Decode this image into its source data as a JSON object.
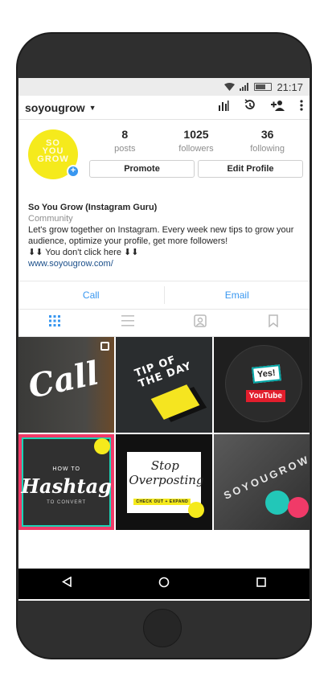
{
  "status_bar": {
    "time": "21:17"
  },
  "header": {
    "username": "soyougrow"
  },
  "profile": {
    "avatar_text": [
      "SO",
      "YOU",
      "GROW"
    ],
    "stats": [
      {
        "value": "8",
        "label": "posts"
      },
      {
        "value": "1025",
        "label": "followers"
      },
      {
        "value": "36",
        "label": "following"
      }
    ],
    "promote_label": "Promote",
    "edit_label": "Edit Profile"
  },
  "bio": {
    "name": "So You Grow (Instagram Guru)",
    "category": "Community",
    "line1": "Let's grow together on Instagram. Every week new tips to grow your",
    "line2": "audience, optimize your profile, get more followers!",
    "line3": "⬇⬇ You don't click here ⬇⬇",
    "link": "www.soyougrow.com/"
  },
  "contact": {
    "call_label": "Call",
    "email_label": "Email"
  },
  "posts": {
    "tile1_text": "Call",
    "tile2_text": "TIP OF THE DAY",
    "tile3_text_top": "Yes!",
    "tile3_text_bottom": "YouTube",
    "tile4_text_top": "HOW TO",
    "tile4_text_main": "Hashtag",
    "tile4_text_bottom": "TO CONVERT",
    "tile5_text_main": "Stop Overposting",
    "tile5_text_bottom": "CHECK OUT + EXPAND",
    "tile6_text": "SOYOUGROW"
  },
  "colors": {
    "accent": "#3897f0",
    "avatar_yellow": "#f5ea1c",
    "phone_body": "#2f2f2f"
  }
}
